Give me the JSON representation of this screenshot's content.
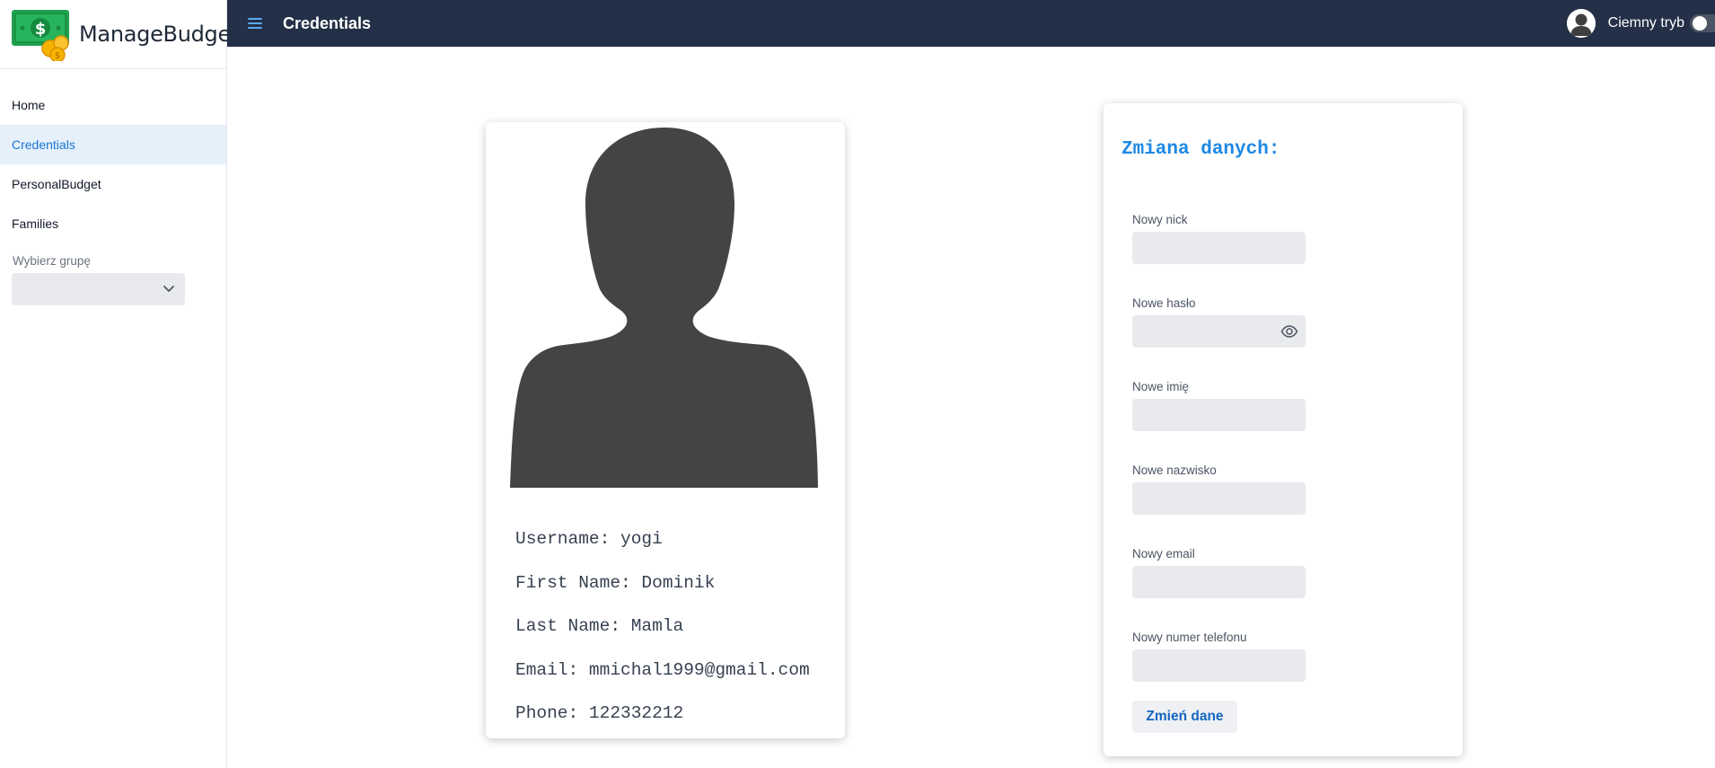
{
  "app": {
    "name": "ManageBudget"
  },
  "sidebar": {
    "items": [
      {
        "label": "Home",
        "active": false
      },
      {
        "label": "Credentials",
        "active": true
      },
      {
        "label": "PersonalBudget",
        "active": false
      },
      {
        "label": "Families",
        "active": false
      }
    ],
    "group_label": "Wybierz grupę",
    "group_value": ""
  },
  "topbar": {
    "title": "Credentials",
    "dark_mode_label": "Ciemny tryb",
    "dark_mode_on": false
  },
  "profile": {
    "username": "Username: yogi",
    "first_name": "First Name: Dominik",
    "last_name": "Last Name: Mamla",
    "email": "Email: mmichal1999@gmail.com",
    "phone": "Phone: 122332212"
  },
  "form": {
    "title": "Zmiana danych:",
    "fields": [
      {
        "label": "Nowy nick",
        "value": ""
      },
      {
        "label": "Nowe hasło",
        "value": ""
      },
      {
        "label": "Nowe imię",
        "value": ""
      },
      {
        "label": "Nowe nazwisko",
        "value": ""
      },
      {
        "label": "Nowy email",
        "value": ""
      },
      {
        "label": "Nowy numer telefonu",
        "value": ""
      }
    ],
    "submit_label": "Zmień dane"
  },
  "colors": {
    "topbar": "#233047",
    "accent": "#1e88e5",
    "active_nav_bg": "#e6f0fb",
    "input_bg": "#e8eaee",
    "silhouette": "#444444"
  },
  "icons": {
    "logo": "money-bill-coins-icon",
    "menu": "hamburger-menu-icon",
    "avatar": "user-avatar-icon",
    "select": "chevron-down-icon",
    "password": "eye-icon"
  }
}
